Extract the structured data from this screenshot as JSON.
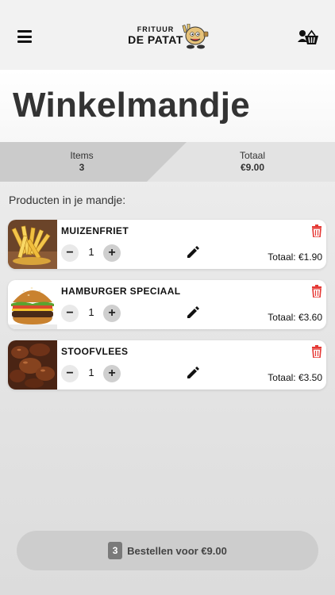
{
  "header": {
    "logo_small": "FRITUUR",
    "logo_big": "DE PATAT",
    "menu_icon": "hamburger-menu-icon",
    "cart_icon": "user-cart-icon"
  },
  "page_title": "Winkelmandje",
  "summary": {
    "items_label": "Items",
    "items_value": "3",
    "total_label": "Totaal",
    "total_value": "€9.00"
  },
  "section_label": "Producten in je mandje:",
  "products": [
    {
      "name": "MUIZENFRIET",
      "quantity": "1",
      "total": "Totaal: €1.90",
      "image": "fries-image"
    },
    {
      "name": "HAMBURGER SPECIAAL",
      "quantity": "1",
      "total": "Totaal: €3.60",
      "image": "burger-image"
    },
    {
      "name": "STOOFVLEES",
      "quantity": "1",
      "total": "Totaal: €3.50",
      "image": "stew-image"
    }
  ],
  "controls": {
    "minus": "−",
    "plus": "+"
  },
  "order": {
    "count": "3",
    "label": "Bestellen voor €9.00"
  },
  "colors": {
    "delete": "#e53935",
    "summary_dark": "#cbcbcb",
    "summary_light": "#e3e3e3",
    "order_button": "#cdcdcd"
  }
}
